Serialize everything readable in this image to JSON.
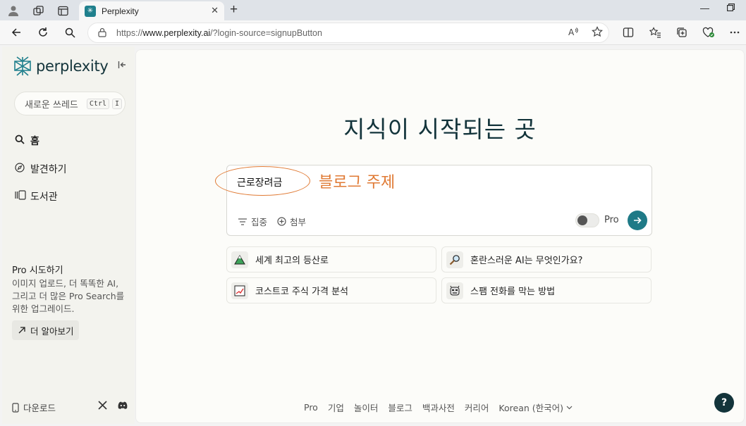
{
  "browser": {
    "tab_title": "Perplexity",
    "tab_close": "✕",
    "new_tab": "+",
    "url_prefix": "https://",
    "url_domain": "www.perplexity.ai",
    "url_path": "/?login-source=signupButton"
  },
  "sidebar": {
    "logo_text": "perplexity",
    "new_thread_label": "새로운 쓰레드",
    "new_thread_kbd_1": "Ctrl",
    "new_thread_kbd_2": "I",
    "nav": [
      {
        "label": "홈",
        "icon": "search-icon"
      },
      {
        "label": "발견하기",
        "icon": "compass-icon"
      },
      {
        "label": "도서관",
        "icon": "library-icon"
      }
    ],
    "promo": {
      "title": "Pro 시도하기",
      "body": "이미지 업로드, 더 똑똑한 AI, 그리고 더 많은 Pro Search를 위한 업그레이드.",
      "button": "더 알아보기"
    },
    "download_label": "다운로드"
  },
  "main": {
    "headline": "지식이 시작되는 곳",
    "search": {
      "query": "근로장려금",
      "annotation": "블로그 주제",
      "focus_label": "집중",
      "attach_label": "첨부",
      "pro_label": "Pro",
      "pro_enabled": false
    },
    "suggestions": [
      {
        "label": "세계 최고의 등산로",
        "icon": "mountain-icon"
      },
      {
        "label": "혼란스러운 AI는 무엇인가요?",
        "icon": "magnifier-icon"
      },
      {
        "label": "코스트코 주식 가격 분석",
        "icon": "chart-icon"
      },
      {
        "label": "스팸 전화를 막는 방법",
        "icon": "robot-face-icon"
      }
    ],
    "footer": [
      "Pro",
      "기업",
      "놀이터",
      "블로그",
      "백과사전",
      "커리어",
      "Korean (한국어)"
    ],
    "help_label": "?"
  },
  "colors": {
    "brand": "#20808d",
    "submit": "#1f7a87",
    "annotation": "#e07a34",
    "headline": "#13343b"
  }
}
